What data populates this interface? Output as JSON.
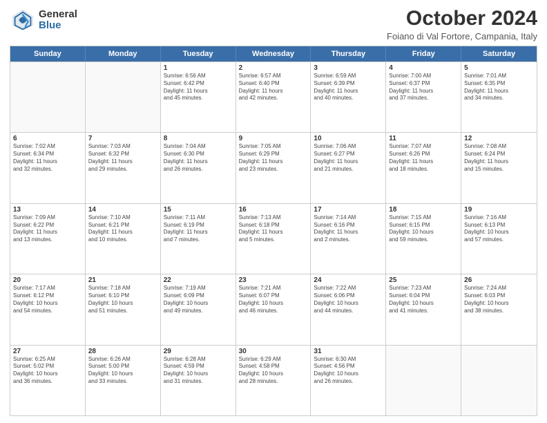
{
  "header": {
    "logo_general": "General",
    "logo_blue": "Blue",
    "title": "October 2024",
    "location": "Foiano di Val Fortore, Campania, Italy"
  },
  "days": [
    "Sunday",
    "Monday",
    "Tuesday",
    "Wednesday",
    "Thursday",
    "Friday",
    "Saturday"
  ],
  "rows": [
    [
      {
        "day": "",
        "info": ""
      },
      {
        "day": "",
        "info": ""
      },
      {
        "day": "1",
        "info": "Sunrise: 6:56 AM\nSunset: 6:42 PM\nDaylight: 11 hours\nand 45 minutes."
      },
      {
        "day": "2",
        "info": "Sunrise: 6:57 AM\nSunset: 6:40 PM\nDaylight: 11 hours\nand 42 minutes."
      },
      {
        "day": "3",
        "info": "Sunrise: 6:59 AM\nSunset: 6:39 PM\nDaylight: 11 hours\nand 40 minutes."
      },
      {
        "day": "4",
        "info": "Sunrise: 7:00 AM\nSunset: 6:37 PM\nDaylight: 11 hours\nand 37 minutes."
      },
      {
        "day": "5",
        "info": "Sunrise: 7:01 AM\nSunset: 6:35 PM\nDaylight: 11 hours\nand 34 minutes."
      }
    ],
    [
      {
        "day": "6",
        "info": "Sunrise: 7:02 AM\nSunset: 6:34 PM\nDaylight: 11 hours\nand 32 minutes."
      },
      {
        "day": "7",
        "info": "Sunrise: 7:03 AM\nSunset: 6:32 PM\nDaylight: 11 hours\nand 29 minutes."
      },
      {
        "day": "8",
        "info": "Sunrise: 7:04 AM\nSunset: 6:30 PM\nDaylight: 11 hours\nand 26 minutes."
      },
      {
        "day": "9",
        "info": "Sunrise: 7:05 AM\nSunset: 6:29 PM\nDaylight: 11 hours\nand 23 minutes."
      },
      {
        "day": "10",
        "info": "Sunrise: 7:06 AM\nSunset: 6:27 PM\nDaylight: 11 hours\nand 21 minutes."
      },
      {
        "day": "11",
        "info": "Sunrise: 7:07 AM\nSunset: 6:26 PM\nDaylight: 11 hours\nand 18 minutes."
      },
      {
        "day": "12",
        "info": "Sunrise: 7:08 AM\nSunset: 6:24 PM\nDaylight: 11 hours\nand 15 minutes."
      }
    ],
    [
      {
        "day": "13",
        "info": "Sunrise: 7:09 AM\nSunset: 6:22 PM\nDaylight: 11 hours\nand 13 minutes."
      },
      {
        "day": "14",
        "info": "Sunrise: 7:10 AM\nSunset: 6:21 PM\nDaylight: 11 hours\nand 10 minutes."
      },
      {
        "day": "15",
        "info": "Sunrise: 7:11 AM\nSunset: 6:19 PM\nDaylight: 11 hours\nand 7 minutes."
      },
      {
        "day": "16",
        "info": "Sunrise: 7:13 AM\nSunset: 6:18 PM\nDaylight: 11 hours\nand 5 minutes."
      },
      {
        "day": "17",
        "info": "Sunrise: 7:14 AM\nSunset: 6:16 PM\nDaylight: 11 hours\nand 2 minutes."
      },
      {
        "day": "18",
        "info": "Sunrise: 7:15 AM\nSunset: 6:15 PM\nDaylight: 10 hours\nand 59 minutes."
      },
      {
        "day": "19",
        "info": "Sunrise: 7:16 AM\nSunset: 6:13 PM\nDaylight: 10 hours\nand 57 minutes."
      }
    ],
    [
      {
        "day": "20",
        "info": "Sunrise: 7:17 AM\nSunset: 6:12 PM\nDaylight: 10 hours\nand 54 minutes."
      },
      {
        "day": "21",
        "info": "Sunrise: 7:18 AM\nSunset: 6:10 PM\nDaylight: 10 hours\nand 51 minutes."
      },
      {
        "day": "22",
        "info": "Sunrise: 7:19 AM\nSunset: 6:09 PM\nDaylight: 10 hours\nand 49 minutes."
      },
      {
        "day": "23",
        "info": "Sunrise: 7:21 AM\nSunset: 6:07 PM\nDaylight: 10 hours\nand 46 minutes."
      },
      {
        "day": "24",
        "info": "Sunrise: 7:22 AM\nSunset: 6:06 PM\nDaylight: 10 hours\nand 44 minutes."
      },
      {
        "day": "25",
        "info": "Sunrise: 7:23 AM\nSunset: 6:04 PM\nDaylight: 10 hours\nand 41 minutes."
      },
      {
        "day": "26",
        "info": "Sunrise: 7:24 AM\nSunset: 6:03 PM\nDaylight: 10 hours\nand 38 minutes."
      }
    ],
    [
      {
        "day": "27",
        "info": "Sunrise: 6:25 AM\nSunset: 5:02 PM\nDaylight: 10 hours\nand 36 minutes."
      },
      {
        "day": "28",
        "info": "Sunrise: 6:26 AM\nSunset: 5:00 PM\nDaylight: 10 hours\nand 33 minutes."
      },
      {
        "day": "29",
        "info": "Sunrise: 6:28 AM\nSunset: 4:59 PM\nDaylight: 10 hours\nand 31 minutes."
      },
      {
        "day": "30",
        "info": "Sunrise: 6:29 AM\nSunset: 4:58 PM\nDaylight: 10 hours\nand 28 minutes."
      },
      {
        "day": "31",
        "info": "Sunrise: 6:30 AM\nSunset: 4:56 PM\nDaylight: 10 hours\nand 26 minutes."
      },
      {
        "day": "",
        "info": ""
      },
      {
        "day": "",
        "info": ""
      }
    ]
  ]
}
